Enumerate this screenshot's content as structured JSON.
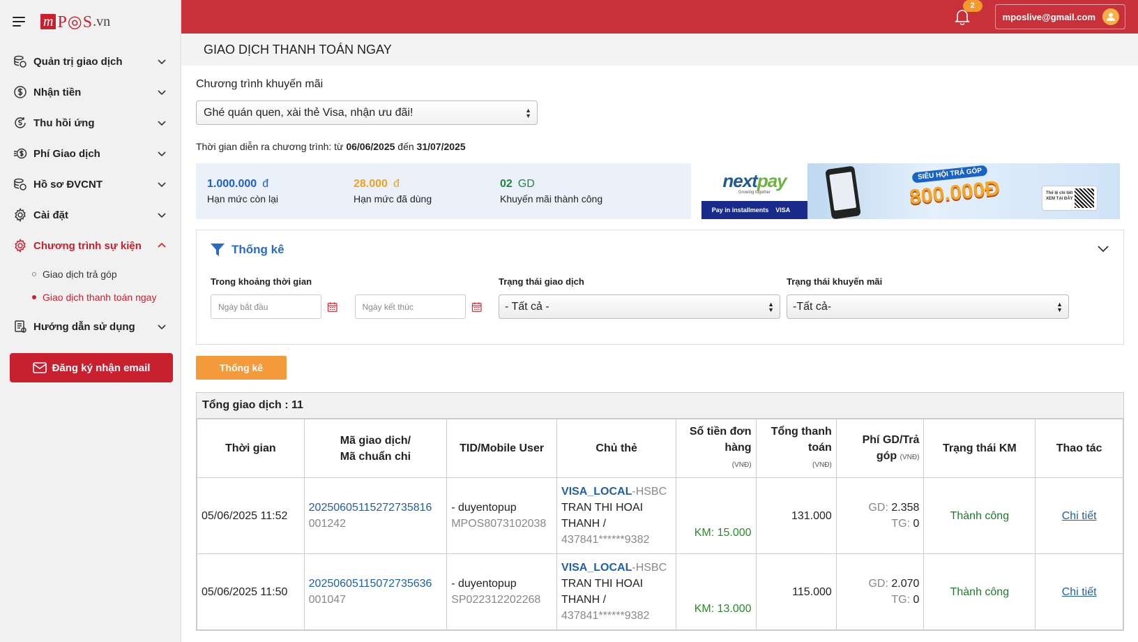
{
  "logo": {
    "m": "m",
    "pos": "P◎S",
    "vn": ".vn"
  },
  "sidebar": {
    "items": [
      {
        "label": "Quản trị giao dịch"
      },
      {
        "label": "Nhận tiền"
      },
      {
        "label": "Thu hồi ứng"
      },
      {
        "label": "Phí Giao dịch"
      },
      {
        "label": "Hồ sơ ĐVCNT"
      },
      {
        "label": "Cài đặt"
      },
      {
        "label": "Chương trình sự kiện"
      },
      {
        "label": "Hướng dẫn sử dụng"
      }
    ],
    "sub_items": [
      {
        "label": "Giao dịch trả góp"
      },
      {
        "label": "Giao dịch thanh toán ngay"
      }
    ],
    "register_button": "Đăng ký nhận email"
  },
  "topbar": {
    "notification_count": "2",
    "user_email": "mposlive@gmail.com"
  },
  "page": {
    "title": "GIAO DỊCH THANH TOÁN NGAY"
  },
  "promo": {
    "label": "Chương trình khuyến mãi",
    "selected": "Ghé quán quen, xài thẻ Visa, nhận ưu đãi!",
    "period_prefix": "Thời gian diễn ra chương trình: từ",
    "start": "06/06/2025",
    "mid": "đến",
    "end": "31/07/2025"
  },
  "limits": [
    {
      "value": "1.000.000",
      "unit": "đ",
      "label": "Hạn mức còn lại",
      "color": "#1f5fc8"
    },
    {
      "value": "28.000",
      "unit": "đ",
      "label": "Hạn mức đã dùng",
      "color": "#f0a21e"
    },
    {
      "value": "02",
      "unit": "GD",
      "label": "Khuyến mãi thành công",
      "color": "#1d8a3a"
    }
  ],
  "banner": {
    "brand_a": "next",
    "brand_b": "pay",
    "tagline": "Growing together",
    "bar_a": "Pay in installments",
    "bar_b": "VISA",
    "badge": "SIÊU HỘI TRẢ GÓP",
    "amount": "800.000Đ",
    "qr_text": "Thể lệ chi tiết XEM TẠI ĐÂY"
  },
  "filter": {
    "title": "Thống kê",
    "time_label": "Trong khoảng thời gian",
    "start_placeholder": "Ngày bắt đầu",
    "end_placeholder": "Ngày kết thúc",
    "tx_status_label": "Trạng thái giao dịch",
    "tx_status_value": "- Tất cả -",
    "promo_status_label": "Trạng thái khuyến mãi",
    "promo_status_value": "-Tất cả-",
    "button": "Thống kê"
  },
  "table": {
    "total_label": "Tổng giao dịch : 11",
    "headers": {
      "time": "Thời gian",
      "code_a": "Mã giao dịch/",
      "code_b": "Mã chuẩn chi",
      "tid": "TID/Mobile User",
      "holder": "Chủ thẻ",
      "order_a": "Số tiền đơn hàng",
      "order_unit": "(VNĐ)",
      "total_a": "Tổng thanh toán",
      "total_unit": "(VNĐ)",
      "fee_a": "Phí GD/Trả góp",
      "fee_unit": "(VNĐ)",
      "km_status": "Trạng thái KM",
      "action": "Thao tác"
    },
    "rows": [
      {
        "time": "05/06/2025 11:52",
        "tx_code": "20250605115272735816",
        "auth_code": "001242",
        "user": "- duyentopup",
        "tid": "MPOS8073102038",
        "card_type": "VISA_LOCAL",
        "bank": "-HSBC",
        "holder": "TRAN THI HOAI THANH /",
        "card_no": "437841******9382",
        "km": "KM: 15.000",
        "total": "131.000",
        "fee_gd_label": "GD:",
        "fee_gd": "2.358",
        "fee_tg_label": "TG:",
        "fee_tg": "0",
        "status": "Thành công",
        "action": "Chi tiết"
      },
      {
        "time": "05/06/2025 11:50",
        "tx_code": "20250605115072735636",
        "auth_code": "001047",
        "user": "- duyentopup",
        "tid": "SP022312202268",
        "card_type": "VISA_LOCAL",
        "bank": "-HSBC",
        "holder": "TRAN THI HOAI THANH /",
        "card_no": "437841******9382",
        "km": "KM: 13.000",
        "total": "115.000",
        "fee_gd_label": "GD:",
        "fee_gd": "2.070",
        "fee_tg_label": "TG:",
        "fee_tg": "0",
        "status": "Thành công",
        "action": "Chi tiết"
      }
    ]
  }
}
